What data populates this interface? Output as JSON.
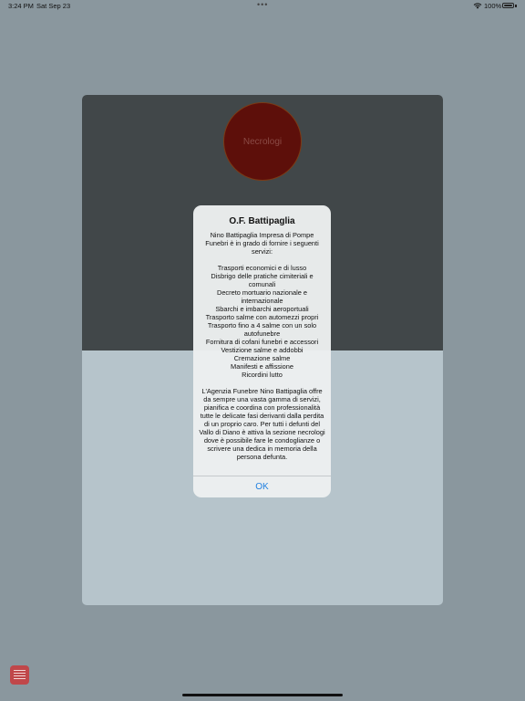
{
  "status_bar": {
    "time": "3:24 PM",
    "date": "Sat Sep 23",
    "dots": "•••",
    "battery_pct": "100%"
  },
  "sheet": {
    "necrologi_label": "Necrologi"
  },
  "alert": {
    "title": "O.F. Battipaglia",
    "message": "Nino Battipaglia Impresa di Pompe Funebri è in grado di fornire i seguenti servizi:\n\nTrasporti economici e di lusso\nDisbrigo delle pratiche cimiteriali e comunali\nDecreto mortuario nazionale e internazionale\nSbarchi e imbarchi aeroportuali\nTrasporto salme con automezzi propri\nTrasporto fino a 4 salme con un solo autofunebre\nFornitura di cofani funebri e accessori\nVestizione salme e addobbi\nCremazione salme\nManifesti e affissione\nRicordini lutto\n\nL'Agenzia Funebre Nino Battipaglia offre da sempre una vasta gamma di servizi, pianifica e coordina con professionalità tutte le delicate fasi derivanti dalla perdita di un proprio caro. Per tutti i defunti del Vallo di Diano è attiva la sezione necrologi dove è possibile fare le condoglianze o scrivere una dedica in memoria della persona defunta.",
    "ok_label": "OK"
  },
  "colors": {
    "background": "#8a979e",
    "header": "#414749",
    "circle": "#5d0f0a",
    "accent": "#1f7fe0",
    "menu_button": "#c0474a"
  },
  "icons": {
    "wifi": "wifi-icon",
    "battery": "battery-icon",
    "menu": "menu-icon"
  }
}
